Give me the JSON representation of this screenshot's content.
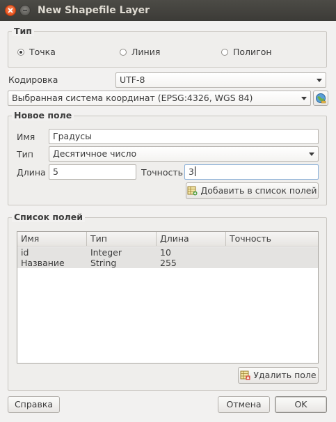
{
  "window": {
    "title": "New Shapefile Layer"
  },
  "type_group": {
    "title": "Тип",
    "options": [
      {
        "label": "Точка",
        "selected": true
      },
      {
        "label": "Линия",
        "selected": false
      },
      {
        "label": "Полигон",
        "selected": false
      }
    ]
  },
  "encoding": {
    "label": "Кодировка",
    "value": "UTF-8"
  },
  "crs": {
    "value": "Выбранная система координат (EPSG:4326, WGS 84)",
    "icon": "globe-icon"
  },
  "new_field": {
    "title": "Новое поле",
    "name_label": "Имя",
    "name_value": "Градусы",
    "type_label": "Тип",
    "type_value": "Десятичное число",
    "length_label": "Длина",
    "length_value": "5",
    "precision_label": "Точность",
    "precision_value": "3",
    "add_button": "Добавить в список полей"
  },
  "field_list": {
    "title": "Список полей",
    "columns": [
      "Имя",
      "Тип",
      "Длина",
      "Точность"
    ],
    "rows": [
      {
        "name": "id",
        "type": "Integer",
        "length": "10",
        "precision": ""
      },
      {
        "name": "Название",
        "type": "String",
        "length": "255",
        "precision": ""
      }
    ],
    "delete_button": "Удалить поле"
  },
  "footer": {
    "help": "Справка",
    "cancel": "Отмена",
    "ok": "OK"
  }
}
